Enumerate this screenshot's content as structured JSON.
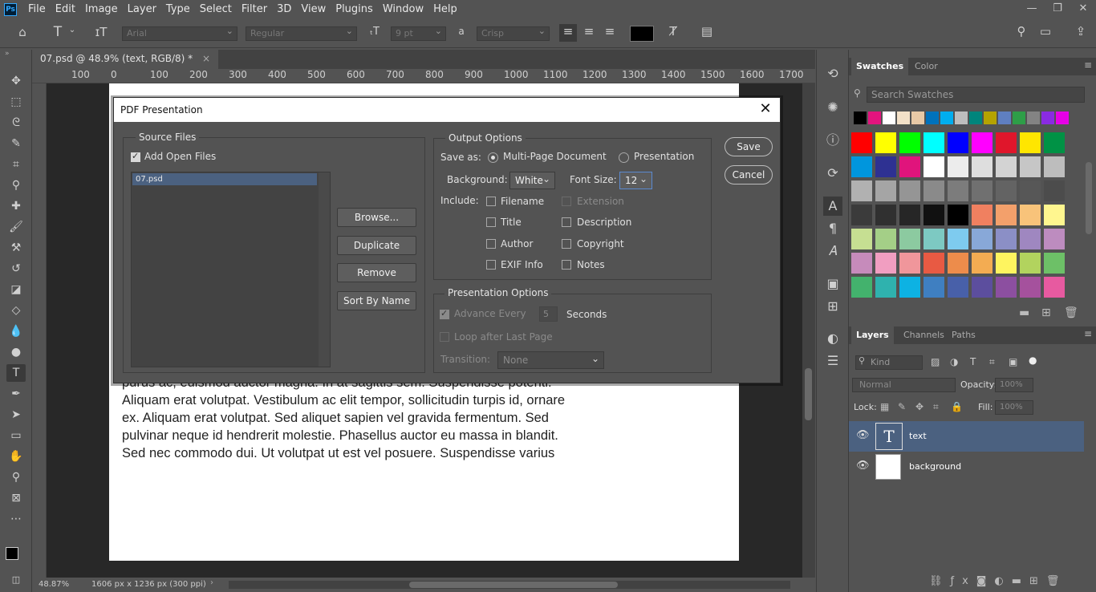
{
  "menubar": {
    "logo": "Ps",
    "items": [
      "File",
      "Edit",
      "Image",
      "Layer",
      "Type",
      "Select",
      "Filter",
      "3D",
      "View",
      "Plugins",
      "Window",
      "Help"
    ]
  },
  "options_bar": {
    "font_family": "Arial",
    "font_style": "Regular",
    "font_size": "9 pt",
    "aa_label": "a",
    "antialias": "Crisp"
  },
  "document": {
    "tab_title": "07.psd @ 48.9% (text, RGB/8) *",
    "tab_close": "×",
    "text_lines": [
      "purus ac, euismod auctor magna. In at sagittis sem. Suspendisse potenti.",
      "Aliquam erat volutpat. Vestibulum ac elit tempor, sollicitudin turpis id, ornare",
      "ex. Aliquam erat volutpat. Sed aliquet sapien vel gravida fermentum. Sed",
      "pulvinar neque id hendrerit molestie. Phasellus auctor eu massa in blandit.",
      "Sed nec commodo dui. Ut volutpat ut est vel posuere. Suspendisse varius"
    ]
  },
  "ruler": {
    "top_ticks": [
      "100",
      "0",
      "100",
      "200",
      "300",
      "400",
      "500",
      "600",
      "700",
      "800",
      "900",
      "1000",
      "1100",
      "1200",
      "1300",
      "1400",
      "1500",
      "1600",
      "1700"
    ]
  },
  "status": {
    "zoom": "48.87%",
    "doc_size": "1606 px x 1236 px (300 ppi)"
  },
  "swatches_panel": {
    "tabs": [
      "Swatches",
      "Color"
    ],
    "search_placeholder": "Search Swatches",
    "recent_colors": [
      "#000000",
      "#e3147e",
      "#ffffff",
      "#f3e1c8",
      "#e8c9a6",
      "#0072bc",
      "#00aeef",
      "#bdbdbd",
      "#00857c",
      "#b5a300",
      "#5f7fc0",
      "#2e9e48",
      "#838383",
      "#8a2be2",
      "#e600e6"
    ],
    "grid_colors": [
      [
        "#ff0000",
        "#ffff00",
        "#00ff00",
        "#00ffff",
        "#0000ff",
        "#ff00ff",
        "#e0162b",
        "#ffe600",
        "#009245"
      ],
      [
        "#0096dd",
        "#2e3192",
        "#e0147c",
        "#ffffff",
        "#ececec",
        "#dedede",
        "#d3d3d3",
        "#c6c6c6",
        "#bdbdbd"
      ],
      [
        "#b1b1b1",
        "#a5a5a5",
        "#959595",
        "#8a8a8a",
        "#7c7c7c",
        "#707070",
        "#636363",
        "#575757",
        "#4c4c4c"
      ],
      [
        "#3b3b3b",
        "#303030",
        "#262626",
        "#111111",
        "#000000",
        "#f08060",
        "#f3a06b",
        "#f8c37a",
        "#fff68f"
      ],
      [
        "#c6df92",
        "#a4cf87",
        "#8ccaa0",
        "#7dc9c2",
        "#7ecbef",
        "#88a8d8",
        "#8b8fc6",
        "#9f87c0",
        "#bd8cbf"
      ],
      [
        "#c68bbb",
        "#f19ec1",
        "#f0969b",
        "#e85a43",
        "#ed8c4b",
        "#f3ac52",
        "#fef45f",
        "#b2d35e",
        "#6dc067"
      ],
      [
        "#43b26d",
        "#2fb2ae",
        "#0db2e3",
        "#3f7fc1",
        "#4860a9",
        "#5c4e9e",
        "#8c4fa0",
        "#a5519d",
        "#e75aa0"
      ]
    ]
  },
  "layers_panel": {
    "tabs": [
      "Layers",
      "Channels",
      "Paths"
    ],
    "kind": "Kind",
    "blend_mode": "Normal",
    "opacity_label": "Opacity:",
    "opacity_value": "100%",
    "lock_label": "Lock:",
    "fill_label": "Fill:",
    "fill_value": "100%",
    "layers": [
      {
        "name": "text",
        "thumb": "T"
      },
      {
        "name": "background",
        "thumb": ""
      }
    ]
  },
  "dialog": {
    "title": "PDF Presentation",
    "close": "✕",
    "source_files": {
      "label": "Source Files",
      "add_open_files": "Add Open Files",
      "files": [
        "07.psd"
      ],
      "browse": "Browse...",
      "duplicate": "Duplicate",
      "remove": "Remove",
      "sort_by_name": "Sort By Name"
    },
    "output_options": {
      "label": "Output Options",
      "save_as_label": "Save as:",
      "multi_page": "Multi-Page Document",
      "presentation": "Presentation",
      "background_label": "Background:",
      "background_value": "White",
      "font_size_label": "Font Size:",
      "font_size_value": "12",
      "include_label": "Include:",
      "filename": "Filename",
      "extension": "Extension",
      "title": "Title",
      "description": "Description",
      "author": "Author",
      "copyright": "Copyright",
      "exif_info": "EXIF Info",
      "notes": "Notes"
    },
    "presentation_options": {
      "label": "Presentation Options",
      "advance_every": "Advance Every",
      "seconds_value": "5",
      "seconds_label": "Seconds",
      "loop": "Loop after Last Page",
      "transition_label": "Transition:",
      "transition_value": "None"
    },
    "save": "Save",
    "cancel": "Cancel"
  }
}
